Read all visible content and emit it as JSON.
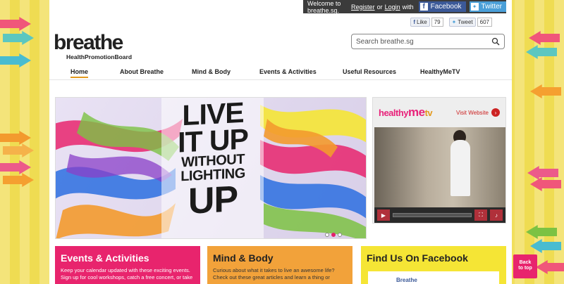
{
  "topbar": {
    "welcome": "Welcome to breathe.sg.",
    "register": "Register",
    "or": "or",
    "login": "Login",
    "with": "with",
    "facebook": "Facebook",
    "twitter": "Twitter"
  },
  "social": {
    "like_label": "Like",
    "like_count": "79",
    "tweet_label": "Tweet",
    "tweet_count": "607"
  },
  "logo": {
    "word": "breathe",
    "sub": "HealthPromotionBoard"
  },
  "search": {
    "placeholder": "Search breathe.sg"
  },
  "nav": {
    "items": [
      "Home",
      "About Breathe",
      "Mind & Body",
      "Events & Activities",
      "Useful Resources",
      "HealthyMeTV"
    ],
    "active": "Home"
  },
  "hero": {
    "line1": "LIVE",
    "line2": "IT UP",
    "line3": "WITHOUT",
    "line4": "LIGHTING",
    "line5": "UP"
  },
  "video": {
    "brand_healthy": "healthy",
    "brand_me": "me",
    "brand_tv": "tv",
    "visit": "Visit Website"
  },
  "cards": {
    "events": {
      "title": "Events & Activities",
      "text": "Keep your calendar updated with these exciting events. Sign up for cool workshops, catch a free concert, or take"
    },
    "mind": {
      "title": "Mind & Body",
      "text": "Curious about what it takes to live an awesome life? Check out these great articles and learn a thing or"
    },
    "fb": {
      "title": "Find Us On Facebook",
      "inner": "Breathe"
    }
  },
  "back_to_top": {
    "line1": "Back",
    "line2": "to top"
  },
  "colors": {
    "accent_pink": "#e8246d",
    "accent_orange": "#f2a23a",
    "accent_yellow": "#f5e535",
    "facebook_blue": "#3b5998",
    "twitter_blue": "#4a9fd8"
  }
}
